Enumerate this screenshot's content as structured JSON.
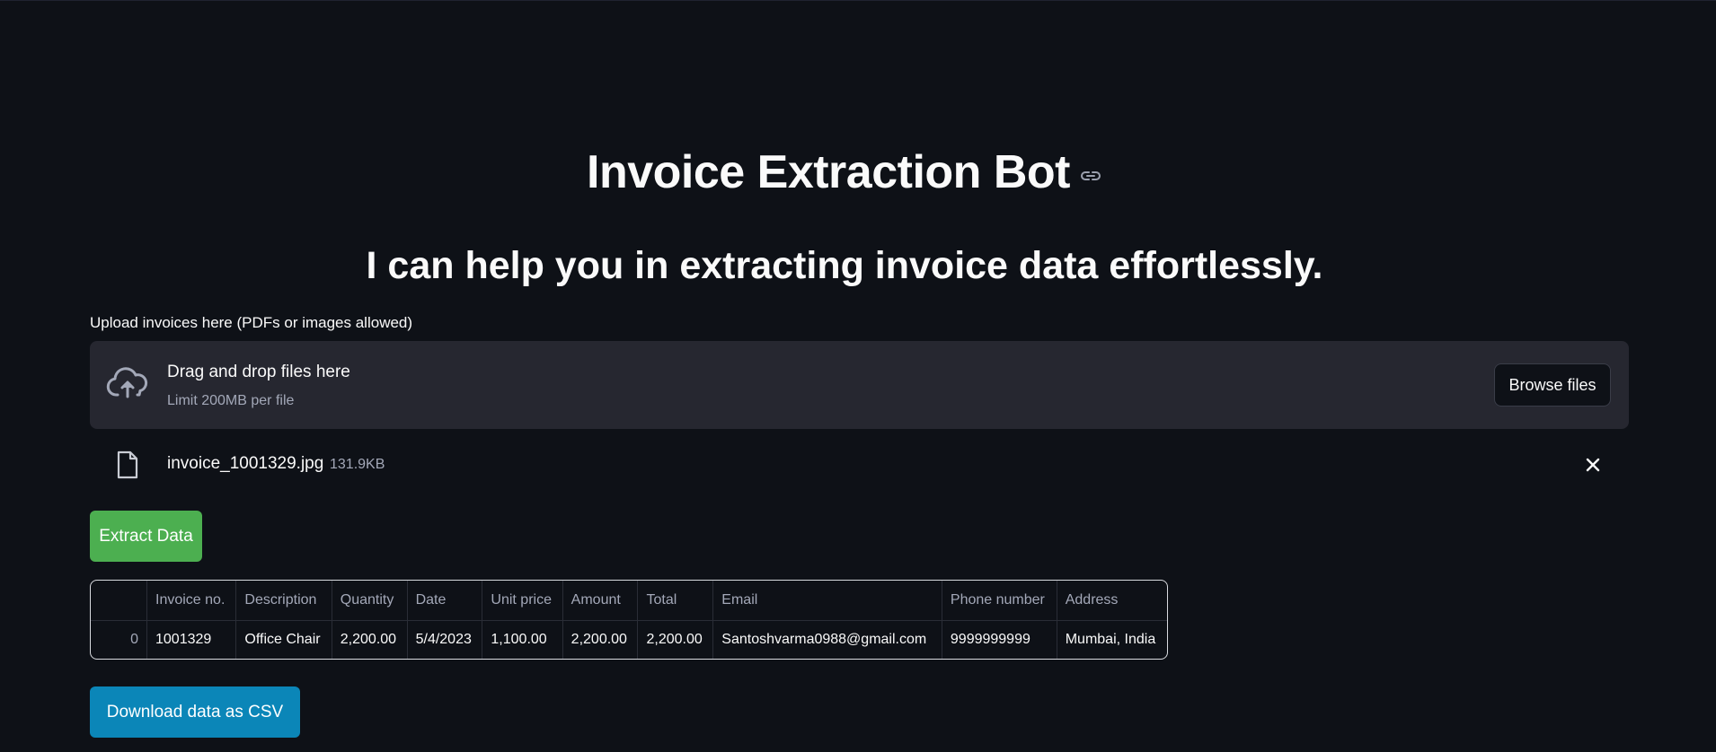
{
  "header": {
    "title": "Invoice Extraction Bot",
    "subtitle": "I can help you in extracting invoice data effortlessly."
  },
  "uploader": {
    "label": "Upload invoices here (PDFs or images allowed)",
    "drop_title": "Drag and drop files here",
    "drop_limit": "Limit 200MB per file",
    "browse_label": "Browse files",
    "file": {
      "name": "invoice_1001329.jpg",
      "size": "131.9KB"
    }
  },
  "actions": {
    "extract_label": "Extract Data",
    "download_label": "Download data as CSV"
  },
  "table": {
    "columns": [
      "",
      "Invoice no.",
      "Description",
      "Quantity",
      "Date",
      "Unit price",
      "Amount",
      "Total",
      "Email",
      "Phone number",
      "Address"
    ],
    "rows": [
      [
        "0",
        "1001329",
        "Office Chair",
        "2,200.00",
        "5/4/2023",
        "1,100.00",
        "2,200.00",
        "2,200.00",
        "Santoshvarma0988@gmail.com",
        "9999999999",
        "Mumbai, India"
      ]
    ]
  },
  "colors": {
    "background": "#0e1117",
    "extract_button": "#4caf50",
    "download_button": "#0b86b8"
  },
  "icons": [
    "link-icon",
    "cloud-upload-icon",
    "file-icon",
    "close-icon"
  ]
}
